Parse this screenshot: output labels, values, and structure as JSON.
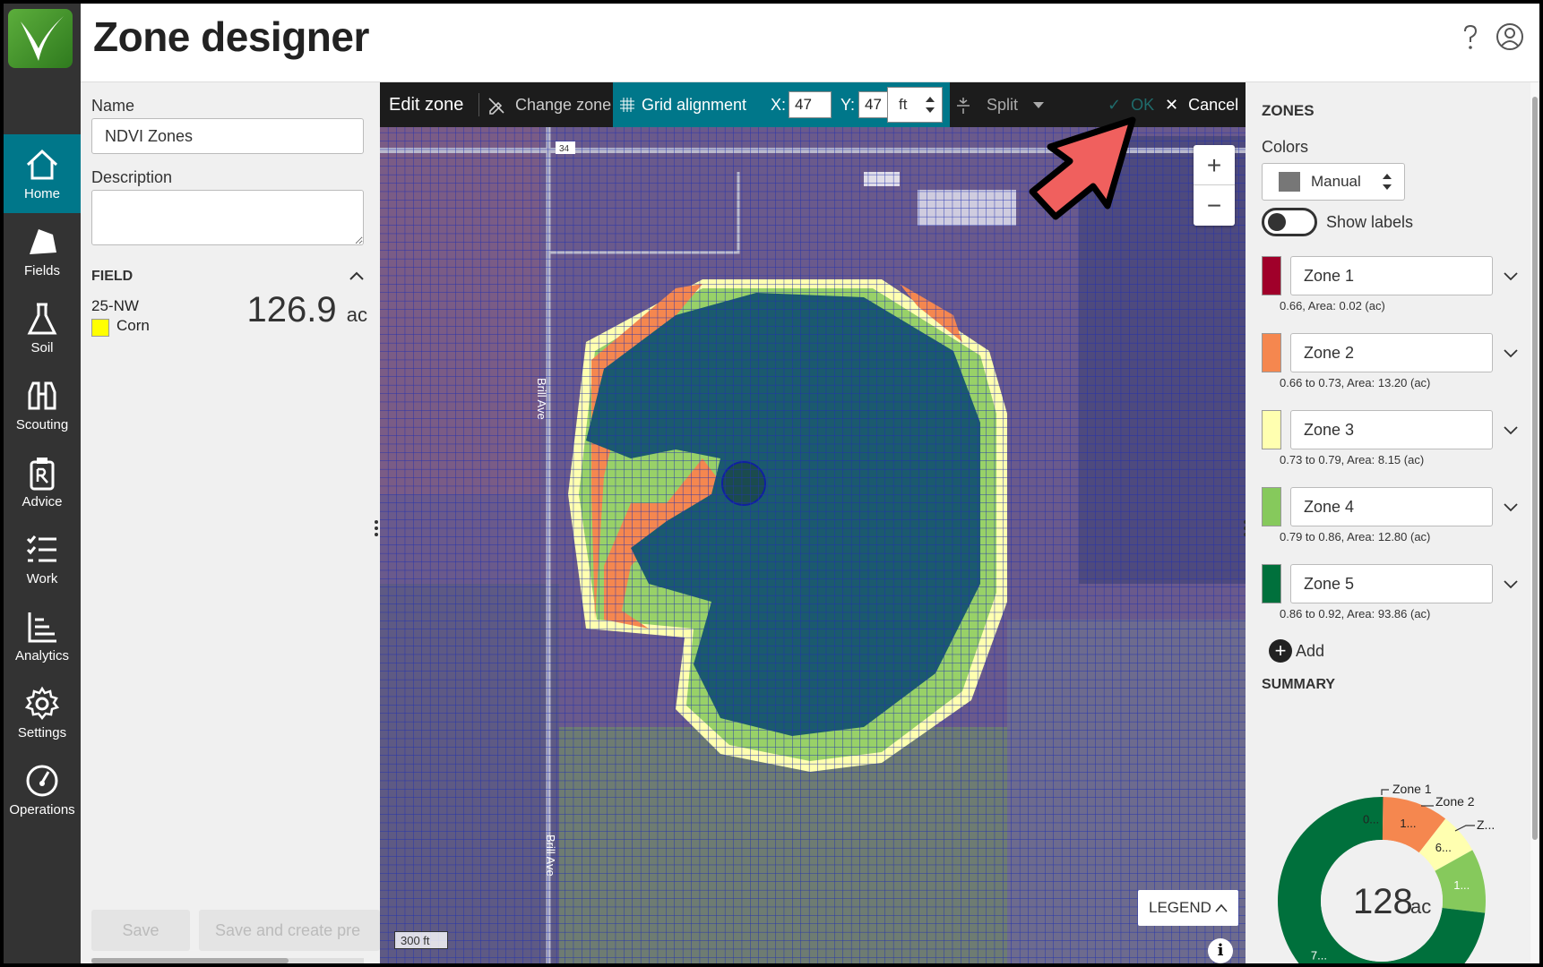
{
  "app": {
    "title": "Zone designer"
  },
  "nav": {
    "items": [
      {
        "label": "Home",
        "icon": "home-icon"
      },
      {
        "label": "Fields",
        "icon": "field-icon"
      },
      {
        "label": "Soil",
        "icon": "flask-icon"
      },
      {
        "label": "Scouting",
        "icon": "binoculars-icon"
      },
      {
        "label": "Advice",
        "icon": "prescription-icon"
      },
      {
        "label": "Work",
        "icon": "checklist-icon"
      },
      {
        "label": "Analytics",
        "icon": "chart-icon"
      },
      {
        "label": "Settings",
        "icon": "gear-icon"
      },
      {
        "label": "Operations",
        "icon": "gauge-icon"
      }
    ],
    "active": "Home"
  },
  "form": {
    "name_label": "Name",
    "name_value": "NDVI Zones",
    "description_label": "Description",
    "description_value": "",
    "field_header": "FIELD",
    "field_name": "25-NW",
    "crop": "Corn",
    "crop_color": "#ffff00",
    "area_value": "126.9",
    "area_unit": "ac",
    "save_label": "Save",
    "save_create_label": "Save and create pre"
  },
  "toolbar": {
    "edit_zone": "Edit zone",
    "change_zone": "Change zone",
    "grid_alignment": "Grid alignment",
    "x_label": "X:",
    "x_value": "47",
    "y_label": "Y:",
    "y_value": "47",
    "unit": "ft",
    "split": "Split",
    "ok": "OK",
    "cancel": "Cancel"
  },
  "map": {
    "legend_label": "LEGEND",
    "scale_label": "300 ft",
    "road_label_1": "Brill Ave",
    "road_label_2": "Brill Ave",
    "road_marker": "34",
    "info": "i"
  },
  "zones": {
    "title": "ZONES",
    "colors_label": "Colors",
    "colors_value": "Manual",
    "show_labels": "Show labels",
    "list": [
      {
        "name": "Zone 1",
        "color": "#a0002a",
        "range": "0.66, Area: 0.02 (ac)"
      },
      {
        "name": "Zone 2",
        "color": "#f5874f",
        "range": "0.66 to 0.73, Area: 13.20 (ac)"
      },
      {
        "name": "Zone 3",
        "color": "#ffffb0",
        "range": "0.73 to 0.79, Area: 8.15 (ac)"
      },
      {
        "name": "Zone 4",
        "color": "#86c95c",
        "range": "0.79 to 0.86, Area: 12.80 (ac)"
      },
      {
        "name": "Zone 5",
        "color": "#00703c",
        "range": "0.86 to 0.92, Area: 93.86 (ac)"
      }
    ],
    "add_label": "Add",
    "summary_title": "SUMMARY"
  },
  "summary": {
    "total_value": "128",
    "total_unit": "ac",
    "slices": [
      {
        "name": "Zone 1",
        "value": 0.02,
        "color": "#a0002a",
        "label": "0..."
      },
      {
        "name": "Zone 2",
        "value": 13.2,
        "color": "#f5874f",
        "label": "1..."
      },
      {
        "name": "Zone 3",
        "value": 8.15,
        "color": "#ffffb0",
        "label": "6..."
      },
      {
        "name": "Zone 4",
        "value": 12.8,
        "color": "#86c95c",
        "label": "1..."
      },
      {
        "name": "Zone 5",
        "value": 93.86,
        "color": "#00703c",
        "label": "7..."
      }
    ],
    "callouts": [
      "Zone 1",
      "Zone 2",
      "Z..."
    ]
  }
}
